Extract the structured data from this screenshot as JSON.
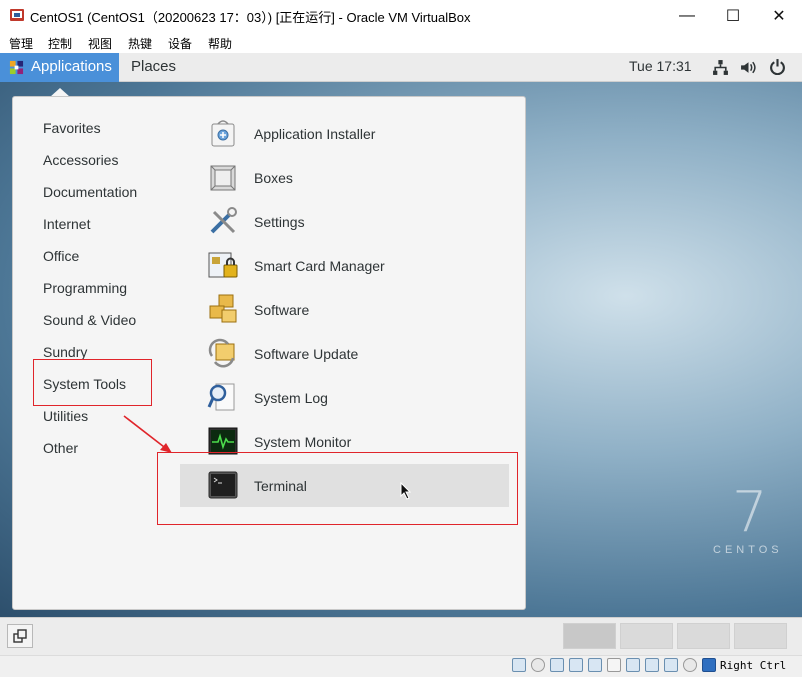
{
  "window": {
    "title": "CentOS1 (CentOS1（20200623 17：03）) [正在运行] - Oracle VM VirtualBox",
    "minimize_glyph": "—",
    "maximize_glyph": "☐",
    "close_glyph": "✕"
  },
  "vbox_menu": [
    "管理",
    "控制",
    "视图",
    "热键",
    "设备",
    "帮助"
  ],
  "gnome_topbar": {
    "applications": "Applications",
    "places": "Places",
    "clock": "Tue 17:31"
  },
  "categories": [
    "Favorites",
    "Accessories",
    "Documentation",
    "Internet",
    "Office",
    "Programming",
    "Sound & Video",
    "Sundry",
    "System Tools",
    "Utilities",
    "Other"
  ],
  "apps": [
    {
      "label": "Application Installer",
      "icon": "application-installer-icon"
    },
    {
      "label": "Boxes",
      "icon": "boxes-icon"
    },
    {
      "label": "Settings",
      "icon": "settings-tools-icon"
    },
    {
      "label": "Smart Card Manager",
      "icon": "smart-card-icon"
    },
    {
      "label": "Software",
      "icon": "software-packages-icon"
    },
    {
      "label": "Software Update",
      "icon": "software-update-icon"
    },
    {
      "label": "System Log",
      "icon": "system-log-icon"
    },
    {
      "label": "System Monitor",
      "icon": "system-monitor-icon"
    },
    {
      "label": "Terminal",
      "icon": "terminal-icon"
    }
  ],
  "desktop": {
    "logo_number": "7",
    "logo_text": "CENTOS"
  },
  "statusbar": {
    "host_key": "Right Ctrl"
  },
  "colors": {
    "accent": "#4a90d9",
    "annotation": "#e0252b"
  }
}
